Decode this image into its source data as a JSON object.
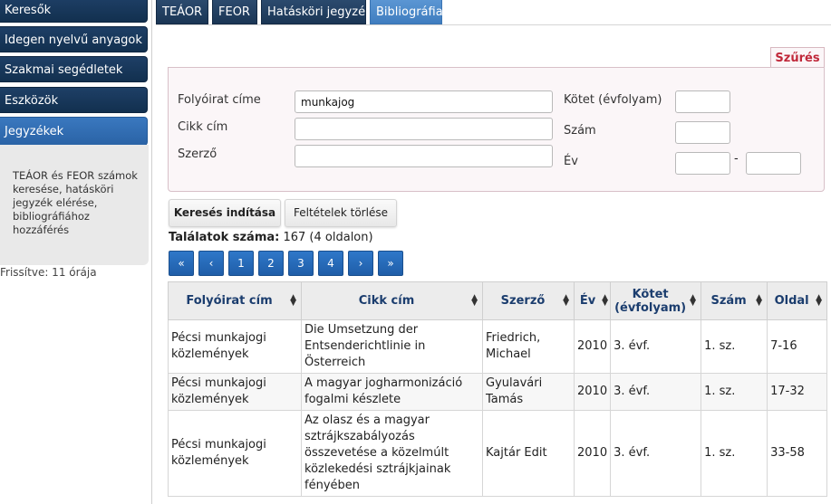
{
  "sidebar": {
    "items": [
      {
        "label": "Keresők"
      },
      {
        "label": "Idegen nyelvű anyagok"
      },
      {
        "label": "Szakmai segédletek"
      },
      {
        "label": "Eszközök"
      },
      {
        "label": "Jegyzékek"
      }
    ],
    "panel_text": "TEÁOR és FEOR számok keresése, hatásköri jegyzék elérése, bibliográfiához hozzáférés",
    "status": "Frissítve: 11 órája"
  },
  "tabs": [
    {
      "label": "TEÁOR"
    },
    {
      "label": "FEOR"
    },
    {
      "label": "Hatásköri jegyzék"
    },
    {
      "label": "Bibliográfia"
    }
  ],
  "filter": {
    "title": "Szűrés",
    "journal_label": "Folyóirat címe",
    "journal_value": "munkajog",
    "article_label": "Cikk cím",
    "author_label": "Szerző",
    "volume_label": "Kötet (évfolyam)",
    "number_label": "Szám",
    "year_label": "Év",
    "year_separator": "-"
  },
  "actions": {
    "search": "Keresés indítása",
    "clear": "Feltételek törlése"
  },
  "results": {
    "label": "Találatok száma:",
    "value": "167 (4 oldalon)"
  },
  "pager": [
    "«",
    "‹",
    "1",
    "2",
    "3",
    "4",
    "›",
    "»"
  ],
  "table": {
    "headers": [
      "Folyóirat cím",
      "Cikk cím",
      "Szerző",
      "Év",
      "Kötet (évfolyam)",
      "Szám",
      "Oldal"
    ],
    "rows": [
      [
        "Pécsi munkajogi közlemények",
        "Die Umsetzung der Entsenderichtlinie in Österreich",
        "Friedrich, Michael",
        "2010",
        "3. évf.",
        "1. sz.",
        "7-16"
      ],
      [
        "Pécsi munkajogi közlemények",
        "A magyar jogharmonizáció fogalmi készlete",
        "Gyulavári Tamás",
        "2010",
        "3. évf.",
        "1. sz.",
        "17-32"
      ],
      [
        "Pécsi munkajogi közlemények",
        "Az olasz és a magyar sztrájkszabályozás összevetése a közelmúlt közlekedési sztrájkjainak fényében",
        "Kajtár Edit",
        "2010",
        "3. évf.",
        "1. sz.",
        "33-58"
      ]
    ]
  }
}
